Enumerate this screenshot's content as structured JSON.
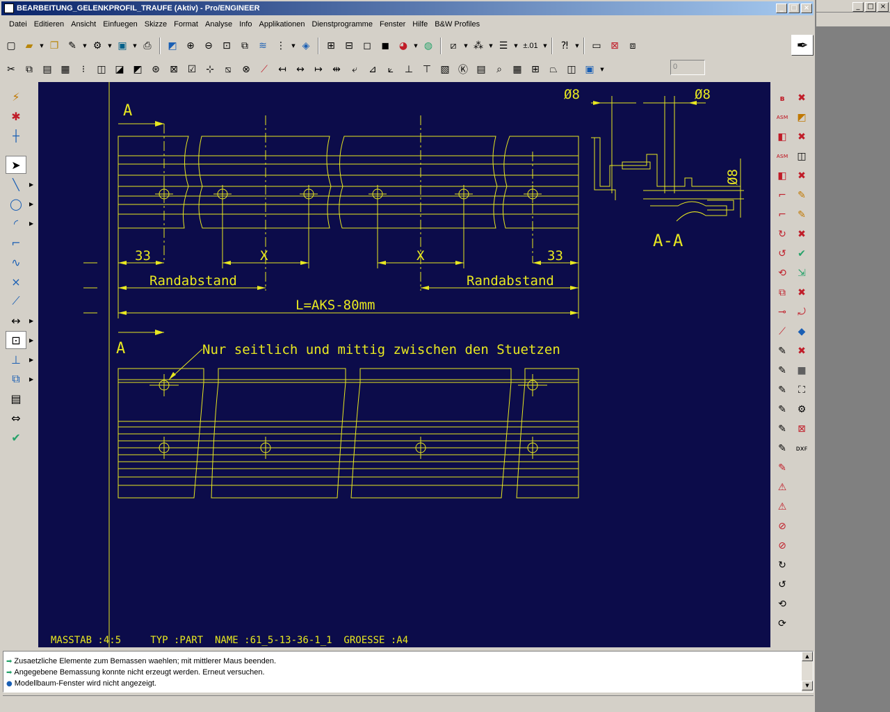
{
  "window": {
    "title": "BEARBEITUNG_GELENKPROFIL_TRAUFE (Aktiv) - Pro/ENGINEER",
    "controls": [
      "_",
      "□",
      "×"
    ]
  },
  "menu": [
    {
      "label": "Datei"
    },
    {
      "label": "Editieren"
    },
    {
      "label": "Ansicht"
    },
    {
      "label": "Einfuegen"
    },
    {
      "label": "Skizze"
    },
    {
      "label": "Format"
    },
    {
      "label": "Analyse"
    },
    {
      "label": "Info"
    },
    {
      "label": "Applikationen"
    },
    {
      "label": "Dienstprogramme"
    },
    {
      "label": "Fenster"
    },
    {
      "label": "Hilfe"
    },
    {
      "label": "B&W Profiles"
    }
  ],
  "toolbar": {
    "tolerance_label": "±.01",
    "number_field": "0"
  },
  "drawing": {
    "section_label_top": "A",
    "section_label_bottom": "A",
    "section_view_label": "A-A",
    "diameter_left": "Ø8",
    "diameter_right": "Ø8",
    "diameter_vertical": "Ø8",
    "dim_33_left": "33",
    "dim_x_left": "X",
    "dim_x_right": "X",
    "dim_33_right": "33",
    "randabstand_left": "Randabstand",
    "randabstand_right": "Randabstand",
    "length_label": "L=AKS-80mm",
    "note": "Nur seitlich und mittig zwischen den Stuetzen",
    "title_block": "MASSTAB :4:5     TYP :PART  NAME :61_5-13-36-1_1  GROESSE :A4"
  },
  "messages": [
    {
      "icon": "green-arrow-icon",
      "text": "Zusaetzliche Elemente zum Bemassen waehlen; mit mittlerer Maus beenden."
    },
    {
      "icon": "green-arrow-icon",
      "text": "Angegebene Bemassung konnte nicht erzeugt werden. Erneut versuchen."
    },
    {
      "icon": "blue-dot-icon",
      "text": "Modellbaum-Fenster wird nicht angezeigt."
    }
  ],
  "colors": {
    "canvas_bg": "#0c0c4a",
    "drawing_line": "#e8e820",
    "title_gradient_start": "#0a246a"
  }
}
